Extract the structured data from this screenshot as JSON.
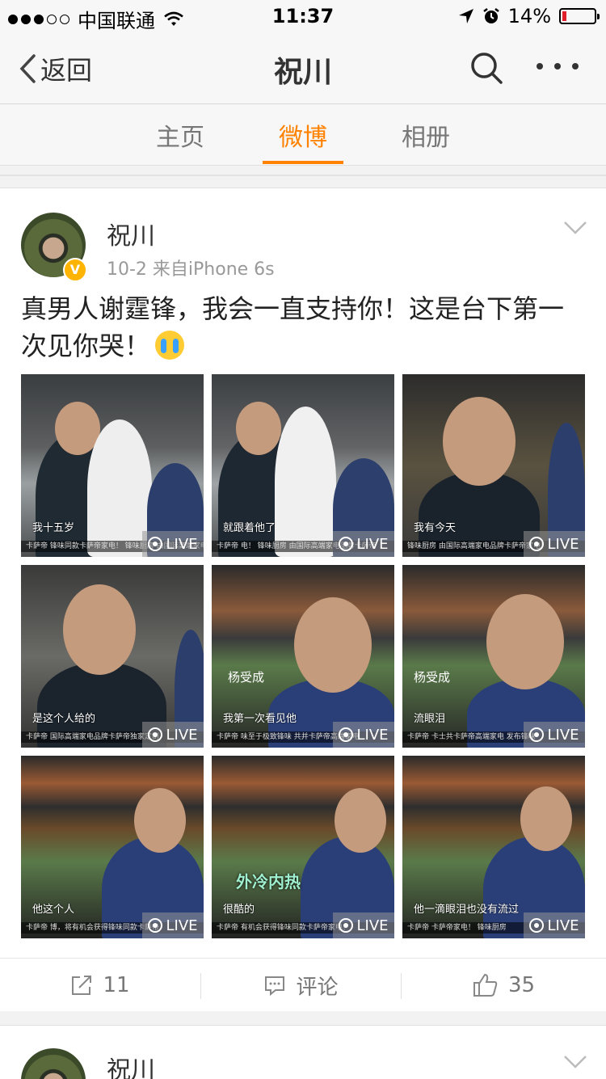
{
  "status_bar": {
    "carrier": "中国联通",
    "time": "11:37",
    "battery": "14%",
    "battery_level": 0.14,
    "signal_bars": 3,
    "icons": [
      "wifi-icon",
      "location-arrow-icon",
      "alarm-icon",
      "battery-icon"
    ]
  },
  "nav": {
    "back_label": "返回",
    "title": "祝川",
    "icons": [
      "chevron-left-icon",
      "search-icon",
      "more-icon"
    ]
  },
  "tabs": [
    {
      "label": "主页",
      "active": false
    },
    {
      "label": "微博",
      "active": true
    },
    {
      "label": "相册",
      "active": false
    }
  ],
  "accent_color": "#ff8200",
  "post": {
    "user": "祝川",
    "meta": "10-2  来自iPhone 6s",
    "verified_badge": "V",
    "text": "真男人谢霆锋，我会一直支持你！这是台下第一次见你哭！",
    "emoji": "crying-face-icon",
    "photos": [
      {
        "caption": "我十五岁",
        "ticker": "卡萨帝  锋味同款卡萨帝家电！   锋味厨房  由国际高端家电",
        "live": "LIVE"
      },
      {
        "caption": "就跟着他了",
        "ticker": "卡萨帝  电！   锋味厨房  由国际高端家电品牌卡萨帝",
        "live": "LIVE"
      },
      {
        "caption": "我有今天",
        "ticker": "锋味厨房  由国际高端家电品牌卡萨帝家电！",
        "live": "LIVE"
      },
      {
        "caption": "是这个人给的",
        "ticker": "卡萨帝  国际高端家电品牌卡萨帝独家定制",
        "live": "LIVE"
      },
      {
        "caption": "我第一次看见他",
        "ticker": "卡萨帝  味至于极致锋味 共并卡萨帝高端家电",
        "name_tag": "杨受成",
        "live": "LIVE"
      },
      {
        "caption": "流眼泪",
        "ticker": "卡萨帝  卡士共卡萨帝高端家电  发布锋味",
        "name_tag": "杨受成",
        "live": "LIVE"
      },
      {
        "caption": "他这个人",
        "ticker": "卡萨帝  博，将有机会获得锋味同款卡萨帝",
        "live": "LIVE"
      },
      {
        "caption": "很酷的",
        "ticker": "卡萨帝  有机会获得锋味同款卡萨帝家电！",
        "title_card": "外冷内热",
        "live": "LIVE"
      },
      {
        "caption": "他一滴眼泪也没有流过",
        "ticker": "卡萨帝  卡萨帝家电！  锋味厨房",
        "live": "LIVE"
      }
    ],
    "actions": {
      "repost_count": "11",
      "comment_label": "评论",
      "like_count": "35"
    }
  },
  "next_post": {
    "user": "祝川"
  }
}
